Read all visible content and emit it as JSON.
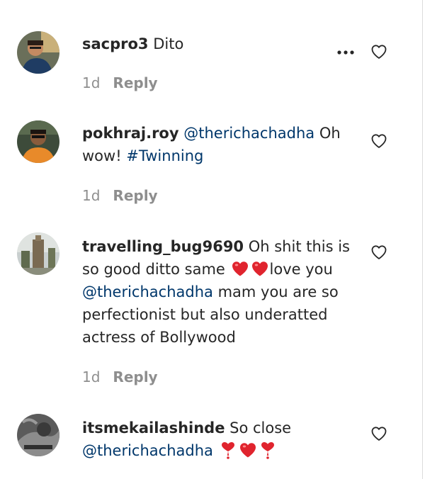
{
  "comments": [
    {
      "username": "sacpro3",
      "text": " Dito",
      "time": "1d",
      "reply_label": "Reply",
      "avatar_icon": "user-avatar"
    },
    {
      "username": "pokhraj.roy",
      "mention": "@therichachadha",
      "text": " Oh wow! ",
      "hashtag": "#Twinning",
      "time": "1d",
      "reply_label": "Reply",
      "avatar_icon": "user-avatar"
    },
    {
      "username": "travelling_bug9690",
      "text_before": " Oh shit this is so good ditto same ",
      "text_after": "love you ",
      "mention": "@therichachadha",
      "text_end": " mam you are so perfectionist but also underatted actress of Bollywood",
      "time": "1d",
      "reply_label": "Reply",
      "avatar_icon": "user-avatar"
    },
    {
      "username": "itsmekailashinde",
      "text": " So close ",
      "mention": "@therichachadha",
      "avatar_icon": "user-avatar"
    }
  ],
  "icons": {
    "like": "heart-outline-icon",
    "more": "more-options-icon",
    "heart_emoji": "red-heart-emoji",
    "heart_exclamation": "heart-exclamation-emoji"
  },
  "colors": {
    "text": "#262626",
    "meta": "#8e8e8e",
    "link": "#00376b",
    "heart_red": "#e0242e"
  }
}
